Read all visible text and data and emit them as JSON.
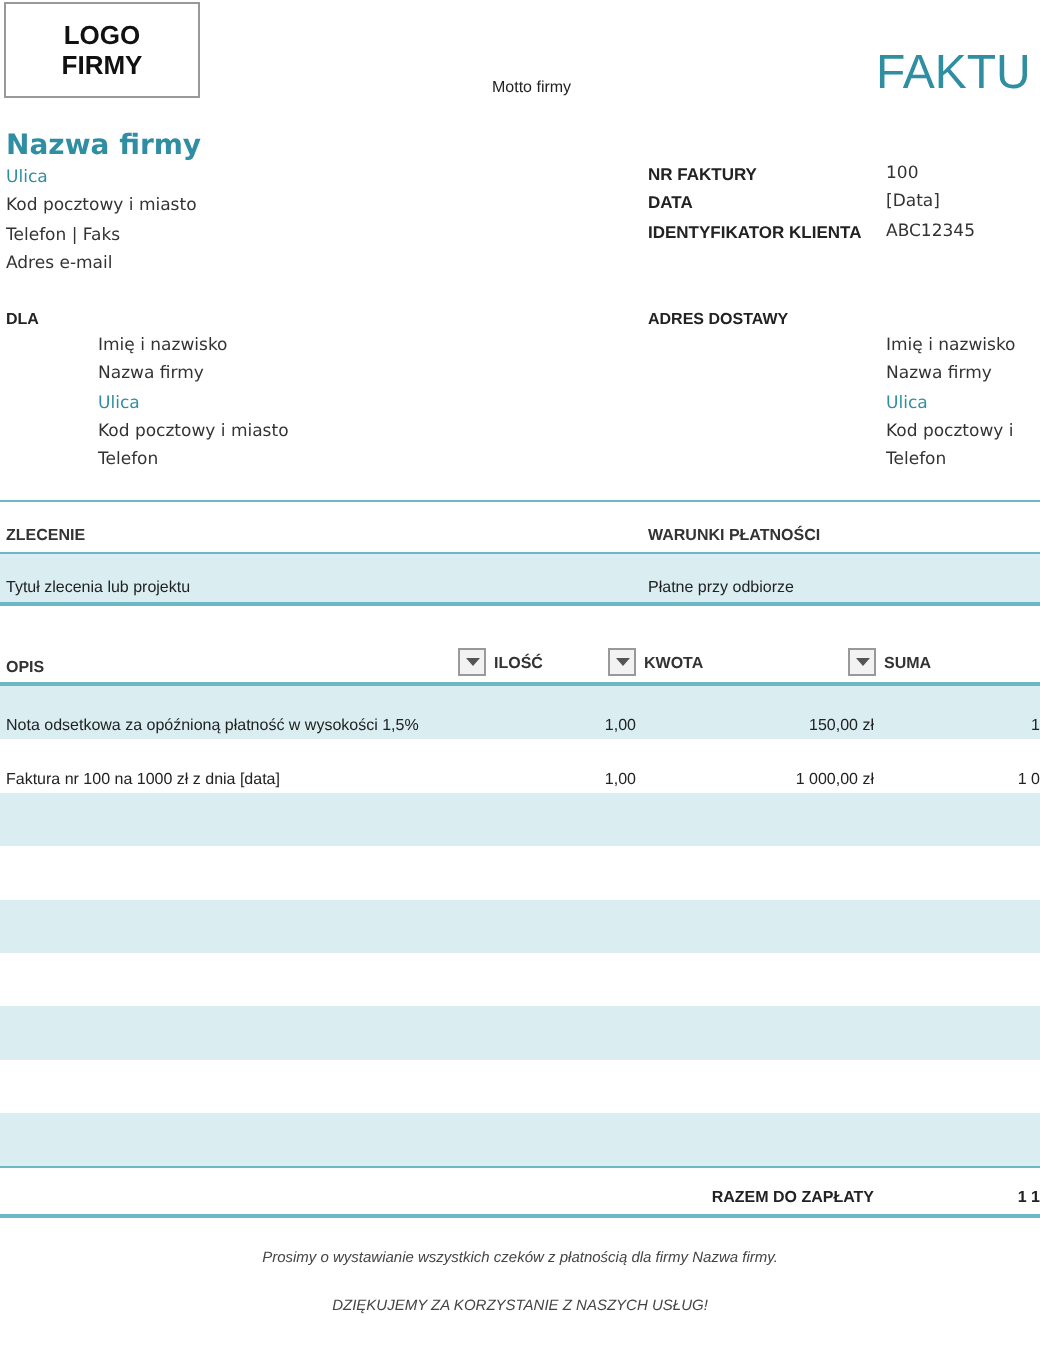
{
  "header": {
    "logo": "LOGO FIRMY",
    "motto": "Motto firmy",
    "title": "FAKTU"
  },
  "company": {
    "name": "Nazwa firmy",
    "lines": [
      "Ulica",
      "Kod pocztowy i miasto",
      "Telefon  |  Faks",
      "Adres e-mail"
    ]
  },
  "invoice_info": [
    {
      "label": "NR FAKTURY",
      "value": "100"
    },
    {
      "label": "DATA",
      "value": "[Data]"
    },
    {
      "label": "IDENTYFIKATOR KLIENTA",
      "value": "ABC12345"
    }
  ],
  "bill_to": {
    "heading": "DLA",
    "lines": [
      "Imię i nazwisko",
      "Nazwa firmy",
      "Ulica",
      "Kod pocztowy i miasto",
      "Telefon"
    ]
  },
  "ship_to": {
    "heading": "ADRES DOSTAWY",
    "lines": [
      "Imię i nazwisko",
      "Nazwa firmy",
      "Ulica",
      "Kod pocztowy i",
      "Telefon"
    ]
  },
  "order": {
    "columns": [
      "ZLECENIE",
      "WARUNKI PŁATNOŚCI"
    ],
    "values": [
      "Tytuł zlecenia lub projektu",
      "Płatne przy odbiorze"
    ]
  },
  "items": {
    "columns": [
      {
        "label": "OPIS",
        "filter": false
      },
      {
        "label": "ILOŚĆ",
        "filter": true
      },
      {
        "label": "KWOTA",
        "filter": true
      },
      {
        "label": "SUMA",
        "filter": true
      }
    ],
    "rows": [
      [
        "Nota odsetkowa za opóźnioną płatność w wysokości 1,5%",
        "1,00",
        "150,00 zł",
        "1"
      ],
      [
        "Faktura nr 100 na 1000 zł z dnia [data]",
        "1,00",
        "1 000,00 zł",
        "1 0"
      ]
    ]
  },
  "total": {
    "label": "RAZEM DO ZAPŁATY",
    "value": "1 1"
  },
  "footer": [
    "Prosimy o wystawianie wszystkich czeków z płatnością dla firmy Nazwa firmy.",
    "DZIĘKUJEMY ZA KORZYSTANIE Z NASZYCH USŁUG!"
  ]
}
